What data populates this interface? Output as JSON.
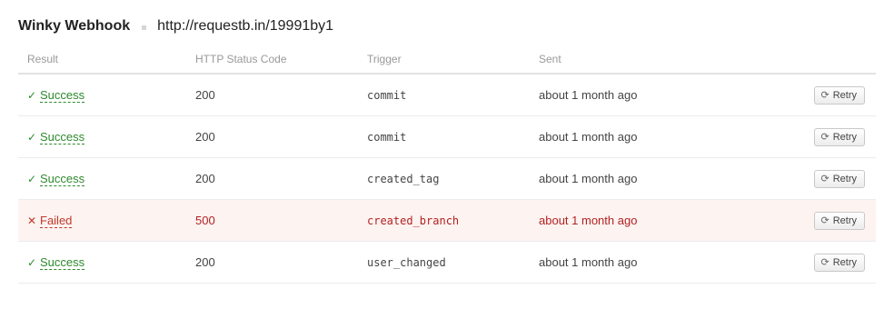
{
  "webhook": {
    "name": "Winky Webhook",
    "url": "http://requestb.in/19991by1"
  },
  "table": {
    "columns": {
      "result": "Result",
      "status": "HTTP Status Code",
      "trigger": "Trigger",
      "sent": "Sent"
    },
    "rows": [
      {
        "result": "Success",
        "result_icon": "check-icon",
        "status": "200",
        "trigger": "commit",
        "sent": "about 1 month ago",
        "action": "Retry"
      },
      {
        "result": "Success",
        "result_icon": "check-icon",
        "status": "200",
        "trigger": "commit",
        "sent": "about 1 month ago",
        "action": "Retry"
      },
      {
        "result": "Success",
        "result_icon": "check-icon",
        "status": "200",
        "trigger": "created_tag",
        "sent": "about 1 month ago",
        "action": "Retry"
      },
      {
        "result": "Failed",
        "result_icon": "cross-icon",
        "status": "500",
        "trigger": "created_branch",
        "sent": "about 1 month ago",
        "action": "Retry"
      },
      {
        "result": "Success",
        "result_icon": "check-icon",
        "status": "200",
        "trigger": "user_changed",
        "sent": "about 1 month ago",
        "action": "Retry"
      }
    ]
  },
  "colors": {
    "success": "#2d8a2d",
    "failed": "#c0392b",
    "failed_row_bg": "#fdf3f1"
  },
  "icons": {
    "retry": "refresh-icon"
  }
}
